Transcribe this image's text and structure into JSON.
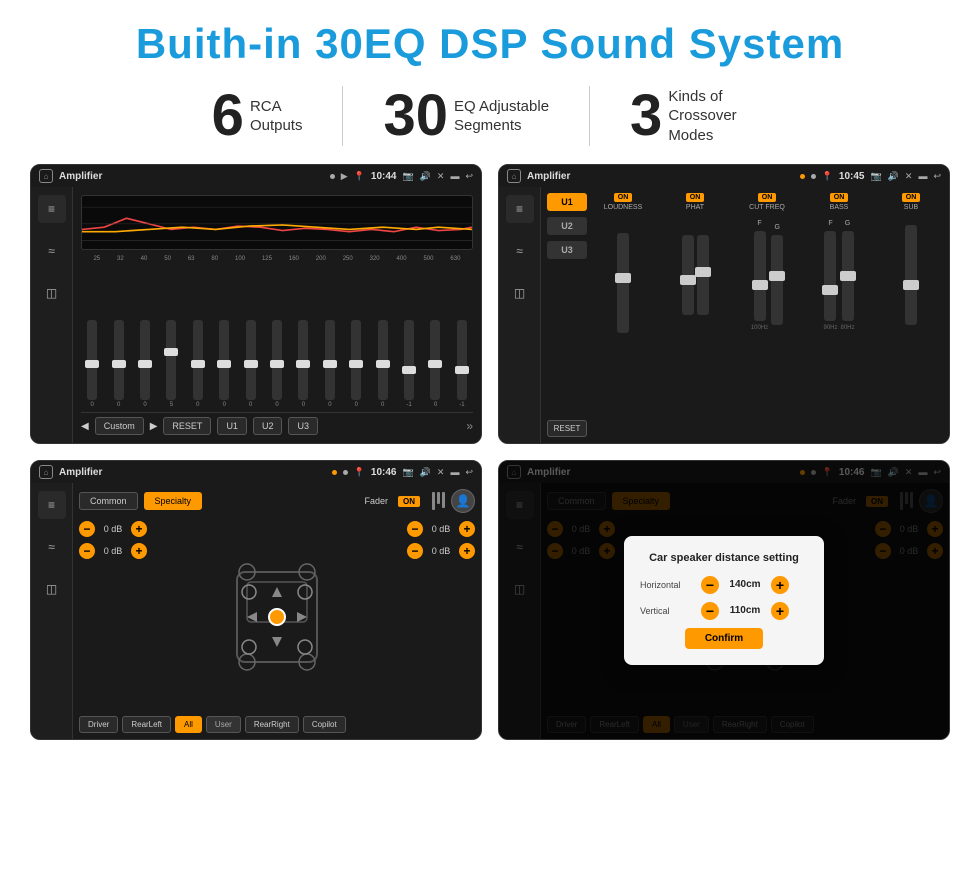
{
  "title": "Buith-in 30EQ DSP Sound System",
  "stats": [
    {
      "number": "6",
      "label_line1": "RCA",
      "label_line2": "Outputs"
    },
    {
      "number": "30",
      "label_line1": "EQ Adjustable",
      "label_line2": "Segments"
    },
    {
      "number": "3",
      "label_line1": "Kinds of",
      "label_line2": "Crossover Modes"
    }
  ],
  "screens": [
    {
      "id": "eq-screen",
      "status_bar": {
        "title": "Amplifier",
        "time": "10:44",
        "icons": [
          "▶",
          "◉"
        ]
      },
      "type": "eq"
    },
    {
      "id": "amp-screen",
      "status_bar": {
        "title": "Amplifier",
        "time": "10:45",
        "icons": [
          "▶",
          "●"
        ]
      },
      "type": "amp",
      "u_buttons": [
        "U1",
        "U2",
        "U3"
      ],
      "channels": [
        {
          "label": "LOUDNESS",
          "on": true
        },
        {
          "label": "PHAT",
          "on": true
        },
        {
          "label": "CUT FREQ",
          "on": true
        },
        {
          "label": "BASS",
          "on": true
        },
        {
          "label": "SUB",
          "on": true
        }
      ]
    },
    {
      "id": "cross-screen",
      "status_bar": {
        "title": "Amplifier",
        "time": "10:46",
        "icons": [
          "▶",
          "●"
        ]
      },
      "type": "crossover",
      "tabs": [
        "Common",
        "Specialty"
      ],
      "active_tab": 1,
      "fader_label": "Fader",
      "fader_on": true,
      "controls": [
        {
          "label": "0 dB"
        },
        {
          "label": "0 dB"
        },
        {
          "label": "0 dB"
        },
        {
          "label": "0 dB"
        }
      ],
      "bottom_btns": [
        "Driver",
        "RearLeft",
        "All",
        "User",
        "RearRight",
        "Copilot"
      ]
    },
    {
      "id": "cross-dialog-screen",
      "status_bar": {
        "title": "Amplifier",
        "time": "10:46",
        "icons": [
          "▶",
          "●"
        ]
      },
      "type": "crossover-dialog",
      "tabs": [
        "Common",
        "Specialty"
      ],
      "active_tab": 1,
      "dialog": {
        "title": "Car speaker distance setting",
        "fields": [
          {
            "label": "Horizontal",
            "value": "140cm"
          },
          {
            "label": "Vertical",
            "value": "110cm"
          }
        ],
        "confirm_label": "Confirm"
      }
    }
  ],
  "eq_freqs": [
    "25",
    "32",
    "40",
    "50",
    "63",
    "80",
    "100",
    "125",
    "160",
    "200",
    "250",
    "320",
    "400",
    "500",
    "630"
  ],
  "eq_values": [
    "0",
    "0",
    "0",
    "5",
    "0",
    "0",
    "0",
    "0",
    "0",
    "0",
    "0",
    "0",
    "-1",
    "0",
    "-1"
  ],
  "on_label": "ON",
  "reset_label": "RESET"
}
